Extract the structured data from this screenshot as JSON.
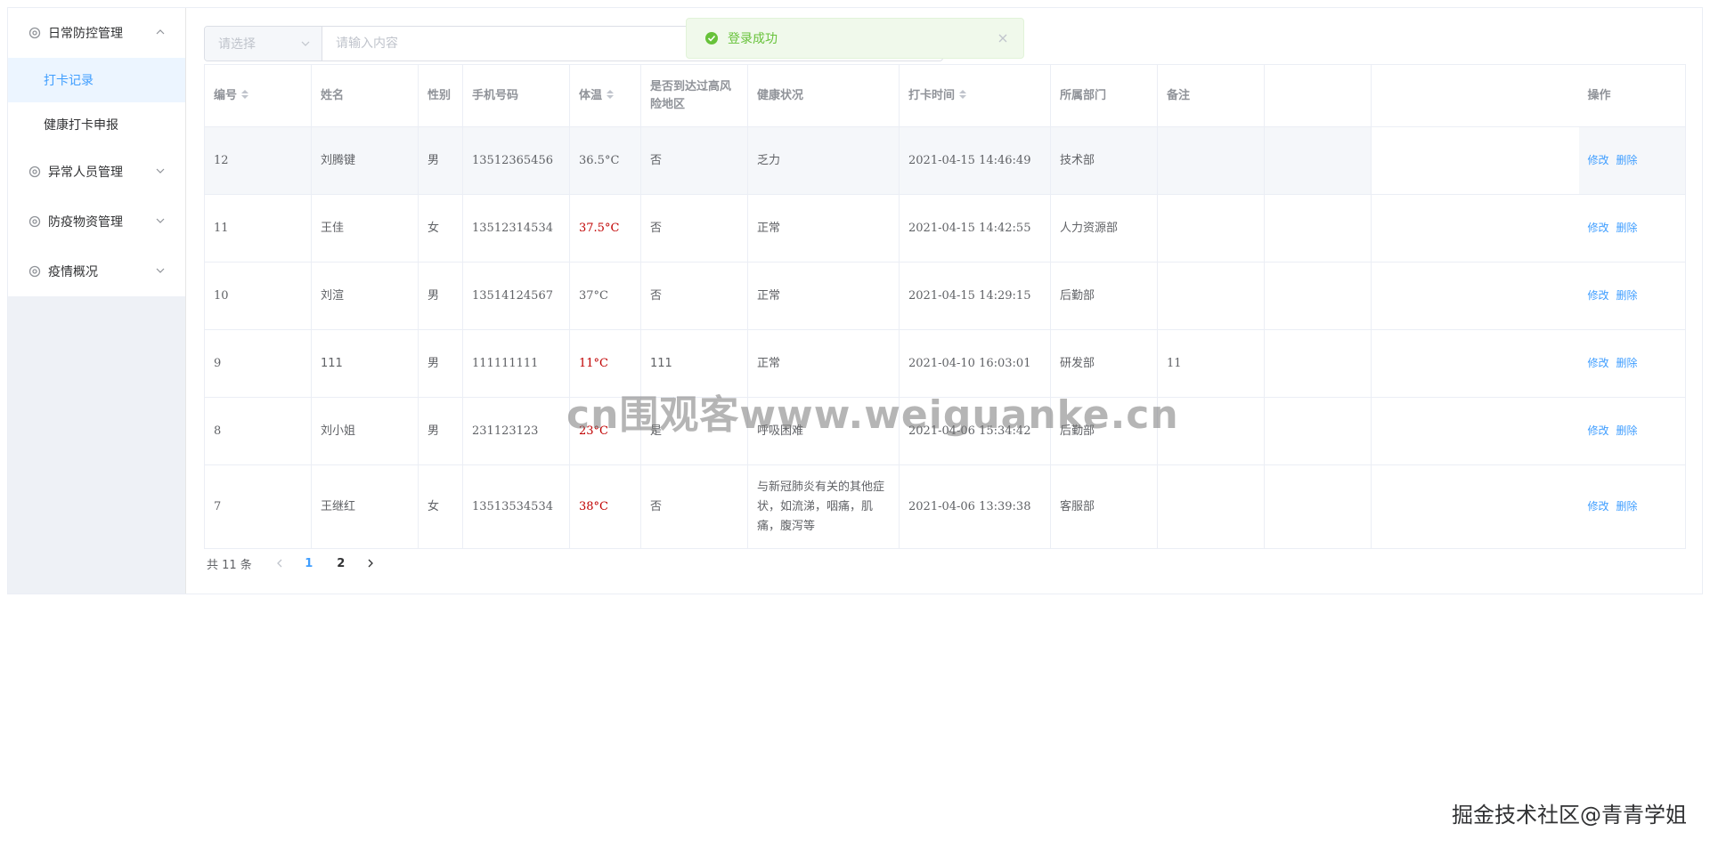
{
  "sidebar": {
    "menus": [
      {
        "title": "日常防控管理",
        "expanded": true,
        "children": [
          "打卡记录",
          "健康打卡申报"
        ],
        "active_child": 0
      },
      {
        "title": "异常人员管理",
        "expanded": false
      },
      {
        "title": "防疫物资管理",
        "expanded": false
      },
      {
        "title": "疫情概况",
        "expanded": false
      }
    ]
  },
  "search": {
    "select_placeholder": "请选择",
    "input_placeholder": "请输入内容"
  },
  "toast": {
    "message": "登录成功",
    "type": "success"
  },
  "table": {
    "headers": {
      "id": "编号",
      "name": "姓名",
      "gender": "性别",
      "phone": "手机号码",
      "temp": "体温",
      "risk": "是否到达过高风险地区",
      "health": "健康状况",
      "time": "打卡时间",
      "dept": "所属部门",
      "note": "备注",
      "ops": "操作"
    },
    "rows": [
      {
        "id": "12",
        "name": "刘腾键",
        "gender": "男",
        "phone": "13512365456",
        "temp": "36.5°C",
        "temp_abnormal": false,
        "risk": "否",
        "health": "乏力",
        "time": "2021-04-15 14:46:49",
        "dept": "技术部",
        "note": ""
      },
      {
        "id": "11",
        "name": "王佳",
        "gender": "女",
        "phone": "13512314534",
        "temp": "37.5°C",
        "temp_abnormal": true,
        "risk": "否",
        "health": "正常",
        "time": "2021-04-15 14:42:55",
        "dept": "人力资源部",
        "note": ""
      },
      {
        "id": "10",
        "name": "刘渲",
        "gender": "男",
        "phone": "13514124567",
        "temp": "37°C",
        "temp_abnormal": false,
        "risk": "否",
        "health": "正常",
        "time": "2021-04-15 14:29:15",
        "dept": "后勤部",
        "note": ""
      },
      {
        "id": "9",
        "name": "111",
        "gender": "男",
        "phone": "111111111",
        "temp": "11°C",
        "temp_abnormal": true,
        "risk": "111",
        "health": "正常",
        "time": "2021-04-10 16:03:01",
        "dept": "研发部",
        "note": "11"
      },
      {
        "id": "8",
        "name": "刘小姐",
        "gender": "男",
        "phone": "231123123",
        "temp": "23°C",
        "temp_abnormal": true,
        "risk": "是",
        "health": "呼吸困难",
        "time": "2021-04-06 15:34:42",
        "dept": "后勤部",
        "note": ""
      },
      {
        "id": "7",
        "name": "王继红",
        "gender": "女",
        "phone": "13513534534",
        "temp": "38°C",
        "temp_abnormal": true,
        "risk": "否",
        "health": "与新冠肺炎有关的其他症状，如流涕，咽痛，肌痛，腹泻等",
        "time": "2021-04-06 13:39:38",
        "dept": "客服部",
        "note": ""
      }
    ],
    "ops": {
      "edit": "修改",
      "delete": "删除"
    }
  },
  "pagination": {
    "total_text": "共 11 条",
    "pages": [
      "1",
      "2"
    ],
    "current": "1"
  },
  "watermarks": {
    "center": "cn围观客www.weiguanke.cn",
    "corner": "掘金技术社区@青青学姐"
  },
  "colors": {
    "primary": "#409eff",
    "success": "#67c23a",
    "danger_temp": "#c00000",
    "active_bg": "#ecf5ff"
  }
}
